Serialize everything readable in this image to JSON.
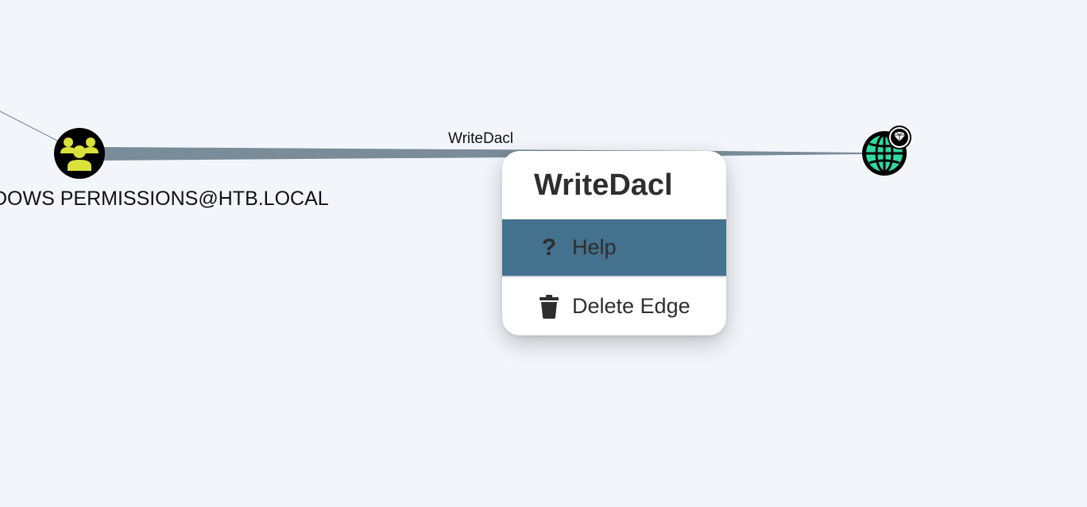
{
  "graph": {
    "nodes": {
      "group": {
        "label": "DOWS PERMISSIONS@HTB.LOCAL",
        "icon": "users-group-icon",
        "fill_color": "#d9e13a"
      },
      "domain": {
        "icon": "globe-icon",
        "badge_icon": "diamond-icon",
        "fill_color": "#2fd9a3"
      }
    },
    "edges": {
      "main": {
        "label": "WriteDacl",
        "color": "#7a8c99"
      }
    }
  },
  "context_menu": {
    "title": "WriteDacl",
    "items": [
      {
        "label": "Help",
        "icon": "help-icon",
        "active": true
      },
      {
        "label": "Delete Edge",
        "icon": "trash-icon",
        "active": false
      }
    ],
    "active_color": "#44718e"
  },
  "theme": {
    "background": "#f2f5fa"
  }
}
